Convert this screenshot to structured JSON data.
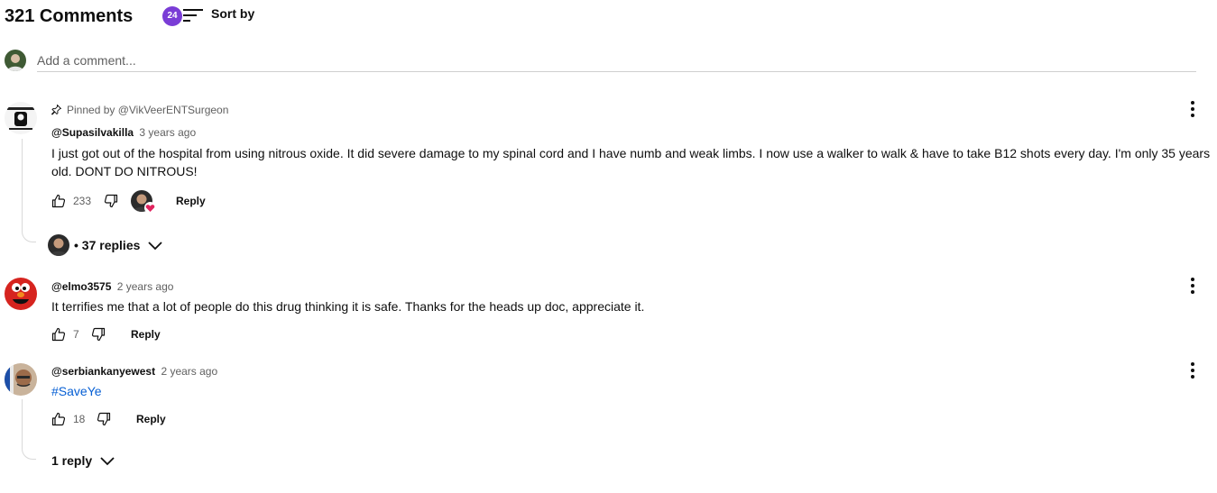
{
  "header": {
    "comment_count": "321 Comments",
    "badge": "24",
    "sort_label": "Sort by"
  },
  "add_comment": {
    "placeholder": "Add a comment..."
  },
  "comments": [
    {
      "pinned_by": "Pinned by @VikVeerENTSurgeon",
      "author": "@Supasilvakilla",
      "time": "3 years ago",
      "text": "I just got out of the hospital from using nitrous oxide. It did severe damage to my spinal cord and I have numb and weak limbs. I now use a walker to walk & have to take B12 shots every day. I'm only 35 years old. DONT DO NITROUS!",
      "likes": "233",
      "reply_label": "Reply",
      "replies_label": "• 37 replies"
    },
    {
      "author": "@elmo3575",
      "time": "2 years ago",
      "text": "It terrifies me that a lot of people do this drug thinking it is safe. Thanks for the heads up doc, appreciate it.",
      "likes": "7",
      "reply_label": "Reply"
    },
    {
      "author": "@serbiankanyewest",
      "time": "2 years ago",
      "text": "#SaveYe",
      "likes": "18",
      "reply_label": "Reply",
      "replies_label": "1 reply"
    }
  ],
  "colors": {
    "badge": "#7a3dd6",
    "link": "#065fd4",
    "secondary_text": "#606060",
    "heart": "#e0245e"
  }
}
